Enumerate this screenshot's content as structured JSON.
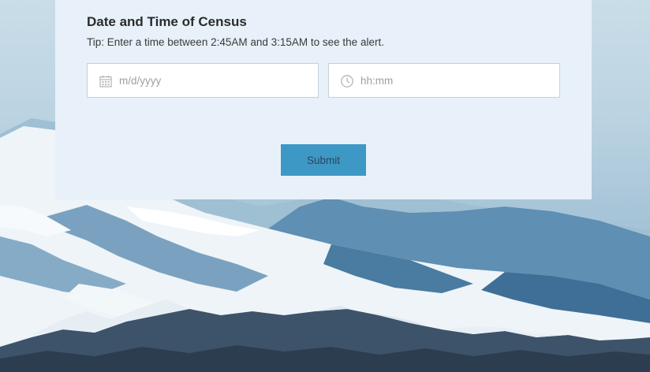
{
  "form": {
    "title": "Date and Time of Census",
    "tip": "Tip: Enter a time between 2:45AM and 3:15AM to see the alert.",
    "date_field": {
      "value": "",
      "placeholder": "m/d/yyyy",
      "icon": "calendar-icon"
    },
    "time_field": {
      "value": "",
      "placeholder": "hh:mm",
      "icon": "clock-icon"
    },
    "submit_label": "Submit"
  },
  "colors": {
    "panel_background": "#e8f1f9",
    "submit_button": "#3e98c6",
    "field_border": "#c8d0d6",
    "placeholder_text": "#a0a0a0"
  }
}
